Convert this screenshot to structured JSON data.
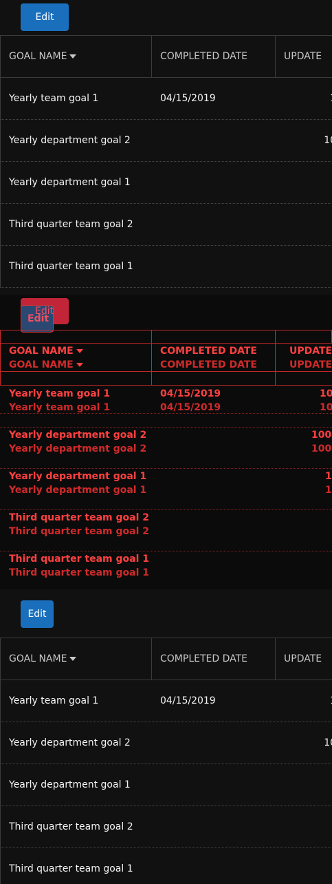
{
  "edit_label": "Edit",
  "columns": [
    "GOAL NAME",
    "COMPLETED DATE",
    "UPDATE"
  ],
  "rows": [
    {
      "name": "Yearly team goal 1",
      "date": "04/15/2019",
      "update": "10"
    },
    {
      "name": "Yearly department goal 2",
      "date": "",
      "update": "100"
    },
    {
      "name": "Yearly department goal 1",
      "date": "",
      "update": "1"
    },
    {
      "name": "Third quarter team goal 2",
      "date": "",
      "update": ""
    },
    {
      "name": "Third quarter team goal 1",
      "date": "",
      "update": ""
    }
  ],
  "colors": {
    "background": "#111111",
    "button": "#1a6fbd",
    "overlay_red": "#ff4040"
  }
}
